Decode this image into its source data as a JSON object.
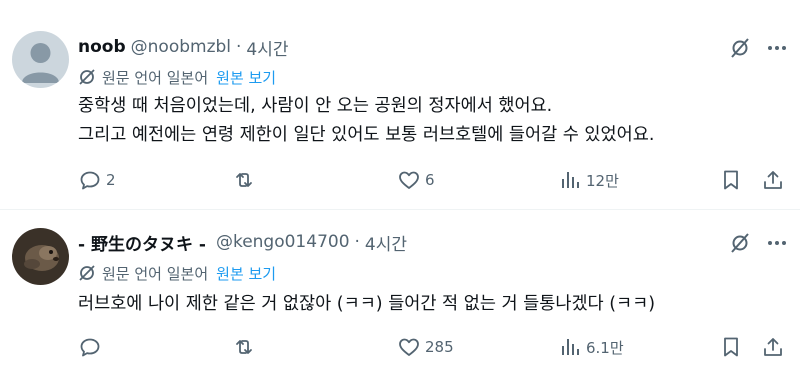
{
  "translate_label": "원문 언어 일본어",
  "show_original_label": "원본 보기",
  "tweets": [
    {
      "name": "noob",
      "handle": "@noobmzbl",
      "time": "4시간",
      "body": [
        "중학생 때 처음이었는데, 사람이 안 오는 공원의 정자에서 했어요.",
        "그리고 예전에는 연령 제한이 일단 있어도 보통 러브호텔에 들어갈 수 있었어요."
      ],
      "replies": "2",
      "retweets": "",
      "likes": "6",
      "views": "12만"
    },
    {
      "name": "- 野生のタヌキ -",
      "handle": "@kengo014700",
      "time": "4시간",
      "body": [
        "러브호에 나이 제한 같은 거 없잖아 (ㅋㅋ) 들어간 적 없는 거 들통나겠다 (ㅋㅋ)"
      ],
      "replies": "",
      "retweets": "",
      "likes": "285",
      "views": "6.1만"
    }
  ],
  "icons": [
    "grok-icon",
    "more-icon",
    "translate-icon",
    "reply-icon",
    "retweet-icon",
    "like-icon",
    "views-icon",
    "bookmark-icon",
    "share-icon"
  ],
  "colors": {
    "text": "#0f1419",
    "secondary": "#536471",
    "link": "#1d9bf0",
    "divider": "#eff3f4"
  }
}
